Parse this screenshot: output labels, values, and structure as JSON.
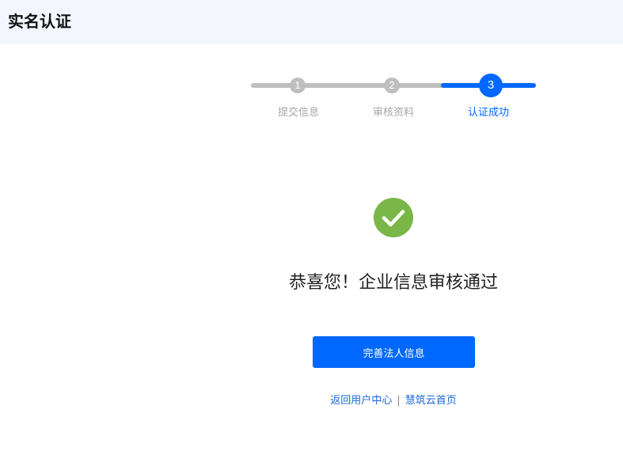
{
  "header": {
    "title": "实名认证"
  },
  "steps": [
    {
      "number": "1",
      "label": "提交信息",
      "state": "done"
    },
    {
      "number": "2",
      "label": "审核资料",
      "state": "done"
    },
    {
      "number": "3",
      "label": "认证成功",
      "state": "active"
    }
  ],
  "result": {
    "icon": "check-circle-icon",
    "message": "恭喜您！企业信息审核通过"
  },
  "actions": {
    "primary_label": "完善法人信息"
  },
  "links": {
    "back": "返回用户中心",
    "separator": "|",
    "home": "慧筑云首页"
  },
  "colors": {
    "primary": "#0068ff",
    "success": "#7ab648",
    "step_done": "#bfbfbf",
    "header_bg": "#f3f7fd"
  }
}
